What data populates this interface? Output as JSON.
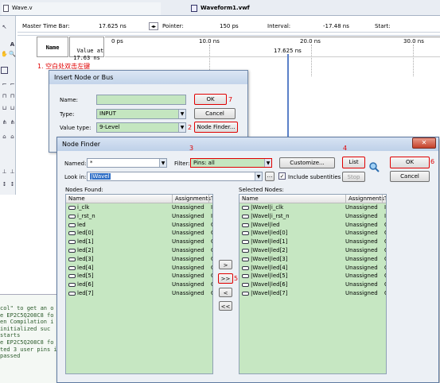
{
  "tabs": {
    "left_file": "Wave.v",
    "vwf_file": "Waveform1.vwf"
  },
  "timebar": {
    "master_label": "Master Time Bar:",
    "master_value": "17.625 ns",
    "pointer_label": "Pointer:",
    "pointer_value": "150 ps",
    "interval_label": "Interval:",
    "interval_value": "-17.48 ns",
    "start_label": "Start:"
  },
  "wave": {
    "col_name": "Name",
    "col_value": "Value at\n17.63 ns",
    "ticks": [
      "0 ps",
      "10.0 ns",
      "20.0 ns",
      "30.0 ns"
    ],
    "cursor_label": "17.625 ns",
    "annotation_1": "1. 空白处双击左键"
  },
  "insert_dialog": {
    "title": "Insert Node or Bus",
    "name_label": "Name:",
    "type_label": "Type:",
    "type_value": "INPUT",
    "value_type_label": "Value type:",
    "value_type_value": "9-Level",
    "ok": "OK",
    "cancel": "Cancel",
    "node_finder": "Node Finder...",
    "ann_7": "7",
    "ann_2": "2"
  },
  "finder": {
    "title": "Node Finder",
    "named_label": "Named:",
    "named_value": "*",
    "filter_label": "Filter:",
    "filter_value": "Pins: all",
    "customize": "Customize...",
    "list": "List",
    "ok": "OK",
    "cancel": "Cancel",
    "lookin_label": "Look in:",
    "lookin_value": "|Wavel",
    "include_sub": "Include subentities",
    "stop": "Stop",
    "nodes_found_label": "Nodes Found:",
    "selected_label": "Selected Nodes:",
    "col_name": "Name",
    "col_assign": "Assignments",
    "col_t": "T",
    "ann_3": "3",
    "ann_4": "4",
    "ann_5": "5",
    "ann_6": "6",
    "move_one": ">",
    "move_all": ">>",
    "remove_one": "<",
    "remove_all": "<<",
    "found_rows": [
      {
        "name": "i_clk",
        "assign": "Unassigned",
        "t": "I"
      },
      {
        "name": "i_rst_n",
        "assign": "Unassigned",
        "t": "I"
      },
      {
        "name": "led",
        "assign": "Unassigned",
        "t": "C"
      },
      {
        "name": "led[0]",
        "assign": "Unassigned",
        "t": "C"
      },
      {
        "name": "led[1]",
        "assign": "Unassigned",
        "t": "C"
      },
      {
        "name": "led[2]",
        "assign": "Unassigned",
        "t": "C"
      },
      {
        "name": "led[3]",
        "assign": "Unassigned",
        "t": "C"
      },
      {
        "name": "led[4]",
        "assign": "Unassigned",
        "t": "C"
      },
      {
        "name": "led[5]",
        "assign": "Unassigned",
        "t": "C"
      },
      {
        "name": "led[6]",
        "assign": "Unassigned",
        "t": "C"
      },
      {
        "name": "led[7]",
        "assign": "Unassigned",
        "t": "C"
      }
    ],
    "selected_rows": [
      {
        "name": "|Wavel|i_clk",
        "assign": "Unassigned",
        "t": "I"
      },
      {
        "name": "|Wavel|i_rst_n",
        "assign": "Unassigned",
        "t": "I"
      },
      {
        "name": "|Wavel|led",
        "assign": "Unassigned",
        "t": "C"
      },
      {
        "name": "|Wavel|led[0]",
        "assign": "Unassigned",
        "t": "C"
      },
      {
        "name": "|Wavel|led[1]",
        "assign": "Unassigned",
        "t": "C"
      },
      {
        "name": "|Wavel|led[2]",
        "assign": "Unassigned",
        "t": "C"
      },
      {
        "name": "|Wavel|led[3]",
        "assign": "Unassigned",
        "t": "C"
      },
      {
        "name": "|Wavel|led[4]",
        "assign": "Unassigned",
        "t": "C"
      },
      {
        "name": "|Wavel|led[5]",
        "assign": "Unassigned",
        "t": "C"
      },
      {
        "name": "|Wavel|led[6]",
        "assign": "Unassigned",
        "t": "C"
      },
      {
        "name": "|Wavel|led[7]",
        "assign": "Unassigned",
        "t": "C"
      }
    ]
  },
  "console": [
    "col\" to get an o",
    "e EP2C5Q208C8 fo",
    "en Compilation i",
    " initialized suc",
    " starts",
    "e EP2C5Q208C8 fo",
    "ted 3 user pins i",
    " passed"
  ]
}
